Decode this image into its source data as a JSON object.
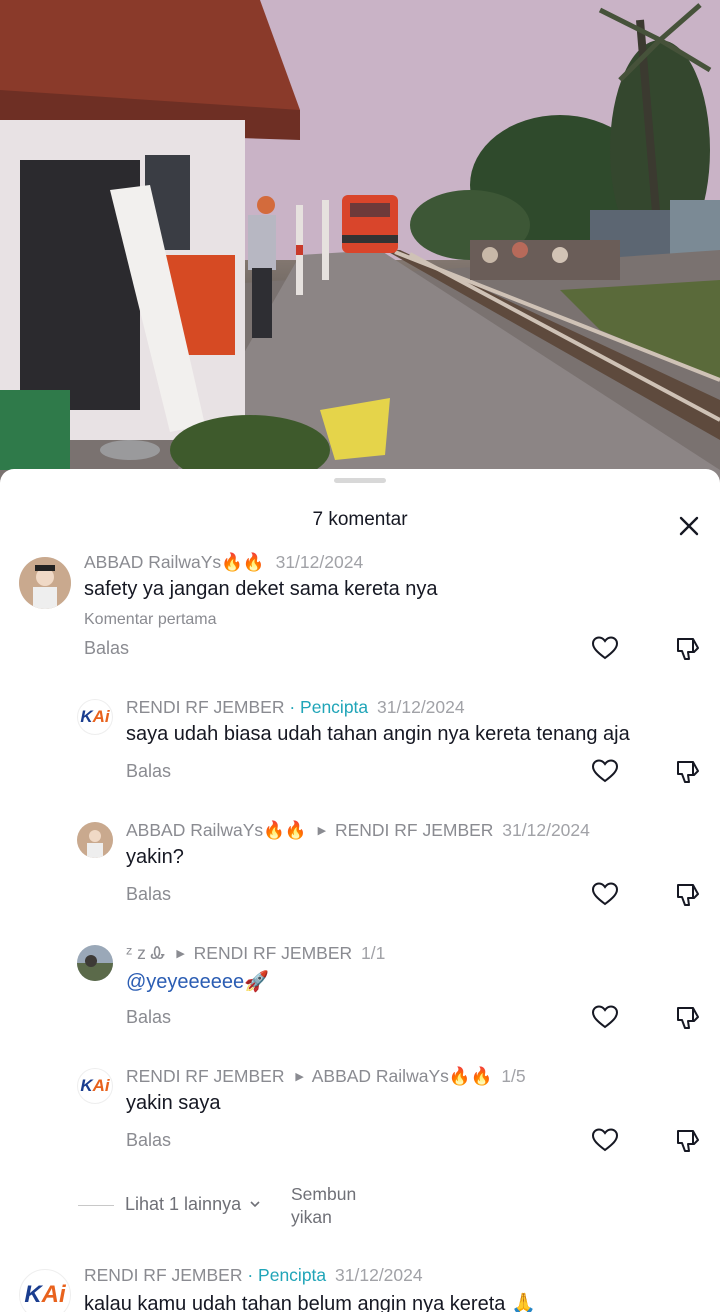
{
  "sheet": {
    "title": "7 komentar"
  },
  "comments": [
    {
      "user": "ABBAD RailwaYs🔥🔥",
      "date": "31/12/2024",
      "text": "safety ya jangan deket sama kereta nya",
      "tag": "Komentar pertama",
      "reply": "Balas"
    },
    {
      "user": "RENDI RF JEMBER",
      "creator": "· Pencipta",
      "date": "31/12/2024",
      "text": "saya udah biasa udah tahan angin nya kereta tenang aja",
      "reply": "Balas"
    },
    {
      "user": "ABBAD RailwaYs🔥🔥",
      "target": "RENDI RF JEMBER",
      "date": "31/12/2024",
      "text": "yakin?",
      "reply": "Balas"
    },
    {
      "user": "ᶻ z Ꮂ",
      "target": "RENDI RF JEMBER",
      "date": "1/1",
      "text": "@yeyeeeeee🚀",
      "reply": "Balas"
    },
    {
      "user": "RENDI RF JEMBER",
      "target": "ABBAD RailwaYs🔥🔥",
      "date": "1/5",
      "text": "yakin saya",
      "reply": "Balas"
    },
    {
      "user": "RENDI RF JEMBER",
      "creator": "· Pencipta",
      "date": "31/12/2024",
      "text": "kalau kamu udah tahan belum angin nya kereta 🙏"
    }
  ],
  "thread_controls": {
    "view_more": "Lihat 1 lainnya",
    "hide": "Sembunyikan",
    "hide_line1": "Sembun",
    "hide_line2": "yikan"
  },
  "avatar_logo": {
    "text_k": "K",
    "text_ai": "Ai"
  },
  "icons": {
    "close": "close-icon",
    "like": "heart-outline-icon",
    "dislike": "thumbs-down-icon",
    "chevron": "chevron-down-icon"
  },
  "colors": {
    "creator_accent": "#20a5b8",
    "mention": "#2b5db3",
    "muted_text": "#8a8b91"
  }
}
